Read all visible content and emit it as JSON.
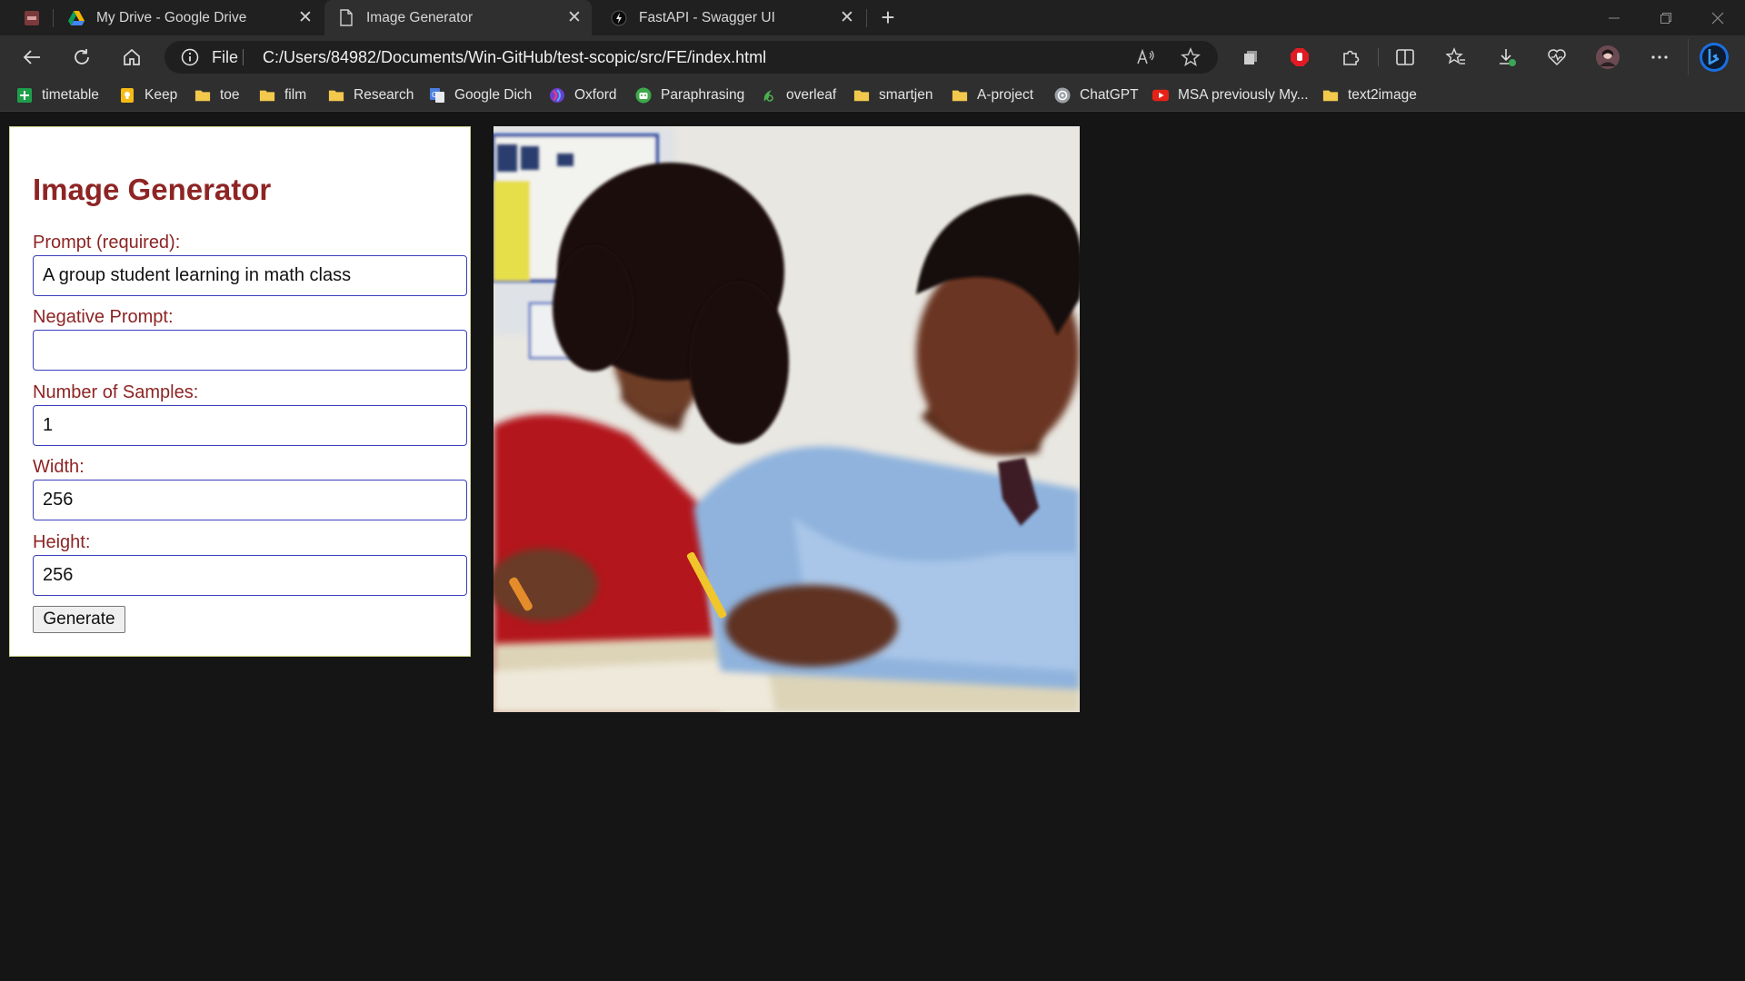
{
  "tabs": [
    {
      "title": "My Drive - Google Drive",
      "icon": "google-drive-icon",
      "active": false
    },
    {
      "title": "Image Generator",
      "icon": "file-icon",
      "active": true
    },
    {
      "title": "FastAPI - Swagger UI",
      "icon": "fastapi-icon",
      "active": false
    }
  ],
  "toolbar": {
    "address_scheme": "File",
    "url": "C:/Users/84982/Documents/Win-GitHub/test-scopic/src/FE/index.html"
  },
  "bookmarks": [
    {
      "label": "timetable",
      "icon": "sheets-plus-icon",
      "color": "#1e9e4a"
    },
    {
      "label": "Keep",
      "icon": "keep-bulb-icon",
      "color": "#f6bb16"
    },
    {
      "label": "toe",
      "icon": "folder-icon",
      "color": "#f2c94c"
    },
    {
      "label": "film",
      "icon": "folder-icon",
      "color": "#f2c94c"
    },
    {
      "label": "Research",
      "icon": "folder-icon",
      "color": "#f2c94c"
    },
    {
      "label": "Google Dich",
      "icon": "google-translate-icon",
      "color": "#4a7fe0"
    },
    {
      "label": "Oxford",
      "icon": "oxford-icon",
      "color": "#6a3fd0"
    },
    {
      "label": "Paraphrasing",
      "icon": "robot-icon",
      "color": "#3ea84a"
    },
    {
      "label": "overleaf",
      "icon": "overleaf-leaf-icon",
      "color": "#4caf50"
    },
    {
      "label": "smartjen",
      "icon": "folder-icon",
      "color": "#f2c94c"
    },
    {
      "label": "A-project",
      "icon": "folder-icon",
      "color": "#f2c94c"
    },
    {
      "label": "ChatGPT",
      "icon": "chatgpt-icon",
      "color": "#9aa0a6"
    },
    {
      "label": "MSA previously My...",
      "icon": "youtube-icon",
      "color": "#e62117"
    },
    {
      "label": "text2image",
      "icon": "folder-icon",
      "color": "#f2c94c"
    }
  ],
  "form": {
    "title": "Image Generator",
    "prompt_label": "Prompt (required):",
    "prompt_value": "A group student learning in math class",
    "negative_label": "Negative Prompt:",
    "negative_value": "",
    "samples_label": "Number of Samples:",
    "samples_value": "1",
    "width_label": "Width:",
    "width_value": "256",
    "height_label": "Height:",
    "height_value": "256",
    "generate_label": "Generate"
  },
  "result": {
    "image_subject": "two-students-writing-in-classroom-photo"
  },
  "colors": {
    "label_red": "#8e2424",
    "input_border": "#3a3fbb",
    "page_bg": "#161516"
  }
}
